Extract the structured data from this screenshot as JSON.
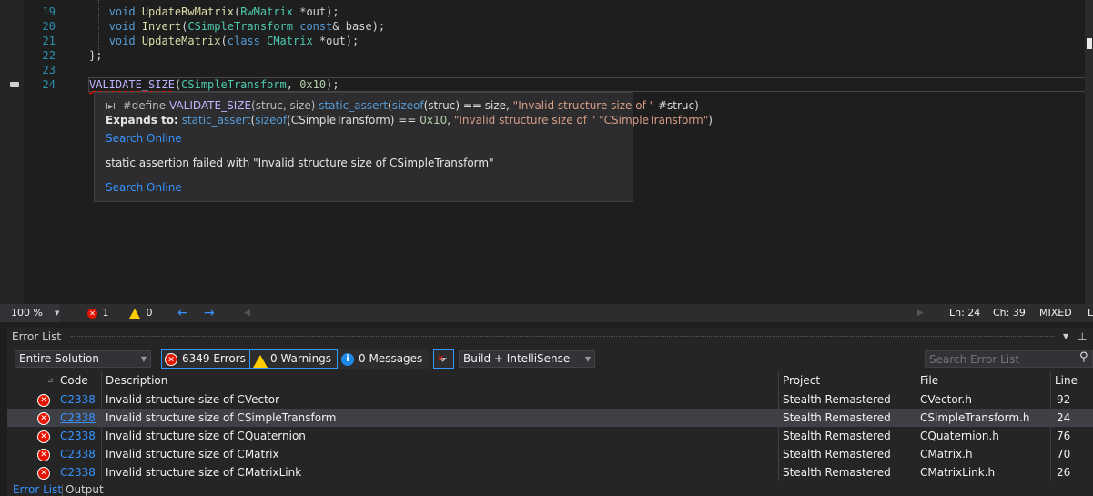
{
  "editor": {
    "lines": [
      {
        "num": "19",
        "parts": [
          [
            "kw",
            "void "
          ],
          [
            "fn",
            "UpdateRwMatrix"
          ],
          [
            "",
            "("
          ],
          [
            "ty",
            "RwMatrix"
          ],
          [
            "",
            " *out);"
          ]
        ]
      },
      {
        "num": "20",
        "parts": [
          [
            "kw",
            "void "
          ],
          [
            "fn",
            "Invert"
          ],
          [
            "",
            "("
          ],
          [
            "ty",
            "CSimpleTransform"
          ],
          [
            "kw",
            " const"
          ],
          [
            "",
            "& base);"
          ]
        ]
      },
      {
        "num": "21",
        "parts": [
          [
            "kw",
            "void "
          ],
          [
            "fn",
            "UpdateMatrix"
          ],
          [
            "",
            "("
          ],
          [
            "kw",
            "class "
          ],
          [
            "ty",
            "CMatrix"
          ],
          [
            "",
            " *out);"
          ]
        ]
      },
      {
        "num": "22",
        "parts": [
          [
            "",
            "};"
          ]
        ]
      },
      {
        "num": "23",
        "parts": []
      },
      {
        "num": "24",
        "parts": [
          [
            "mac",
            "VALIDATE_SIZE"
          ],
          [
            "",
            "("
          ],
          [
            "ty",
            "CSimpleTransform"
          ],
          [
            "",
            ", "
          ],
          [
            "num",
            "0x10"
          ],
          [
            "",
            ");"
          ]
        ]
      }
    ]
  },
  "tooltip": {
    "define_prefix": "#define ",
    "define_macro": "VALIDATE_SIZE",
    "define_params": "(struc, size) ",
    "define_assert": "static_assert",
    "define_open": "(",
    "define_sizeof": "sizeof",
    "define_mid": "(struc) == size, ",
    "define_str": "\"Invalid structure size of \"",
    "define_tail": " #struc)",
    "expands_label": "Expands to:",
    "expands_assert": "static_assert",
    "expands_open": "(",
    "expands_sizeof": "sizeof",
    "expands_type": "(CSimpleTransform) == ",
    "expands_num": "0x10",
    "expands_comma": ", ",
    "expands_str": "\"Invalid structure size of \" \"CSimpleTransform\"",
    "expands_close": ")",
    "search_online_1": "Search Online",
    "message": "static assertion failed with \"Invalid structure size of CSimpleTransform\"",
    "search_online_2": "Search Online"
  },
  "editor_status": {
    "zoom": "100 %",
    "errors": "1",
    "warnings": "0",
    "ln": "Ln: 24",
    "ch": "Ch: 39",
    "eol": "MIXED",
    "extra": "L"
  },
  "panel": {
    "title": "Error List",
    "scope": "Entire Solution",
    "errors_btn": "6349 Errors",
    "warnings_btn": "0 Warnings",
    "messages_btn": "0 Messages",
    "build_filter": "Build + IntelliSense",
    "search_placeholder": "Search Error List",
    "columns": {
      "code": "Code",
      "description": "Description",
      "project": "Project",
      "file": "File",
      "line": "Line"
    },
    "rows": [
      {
        "code": "C2338",
        "description": "Invalid structure size of CVector",
        "project": "Stealth Remastered",
        "file": "CVector.h",
        "line": "92"
      },
      {
        "code": "C2338",
        "description": "Invalid structure size of CSimpleTransform",
        "project": "Stealth Remastered",
        "file": "CSimpleTransform.h",
        "line": "24"
      },
      {
        "code": "C2338",
        "description": "Invalid structure size of CQuaternion",
        "project": "Stealth Remastered",
        "file": "CQuaternion.h",
        "line": "76"
      },
      {
        "code": "C2338",
        "description": "Invalid structure size of CMatrix",
        "project": "Stealth Remastered",
        "file": "CMatrix.h",
        "line": "70"
      },
      {
        "code": "C2338",
        "description": "Invalid structure size of CMatrixLink",
        "project": "Stealth Remastered",
        "file": "CMatrixLink.h",
        "line": "26"
      }
    ],
    "selected_row": 1,
    "tabs": [
      "Error List",
      "Output"
    ]
  },
  "colors": {
    "accent": "#3399ff",
    "error": "#e51400",
    "warning": "#ffcc00",
    "link": "#3794ff"
  }
}
